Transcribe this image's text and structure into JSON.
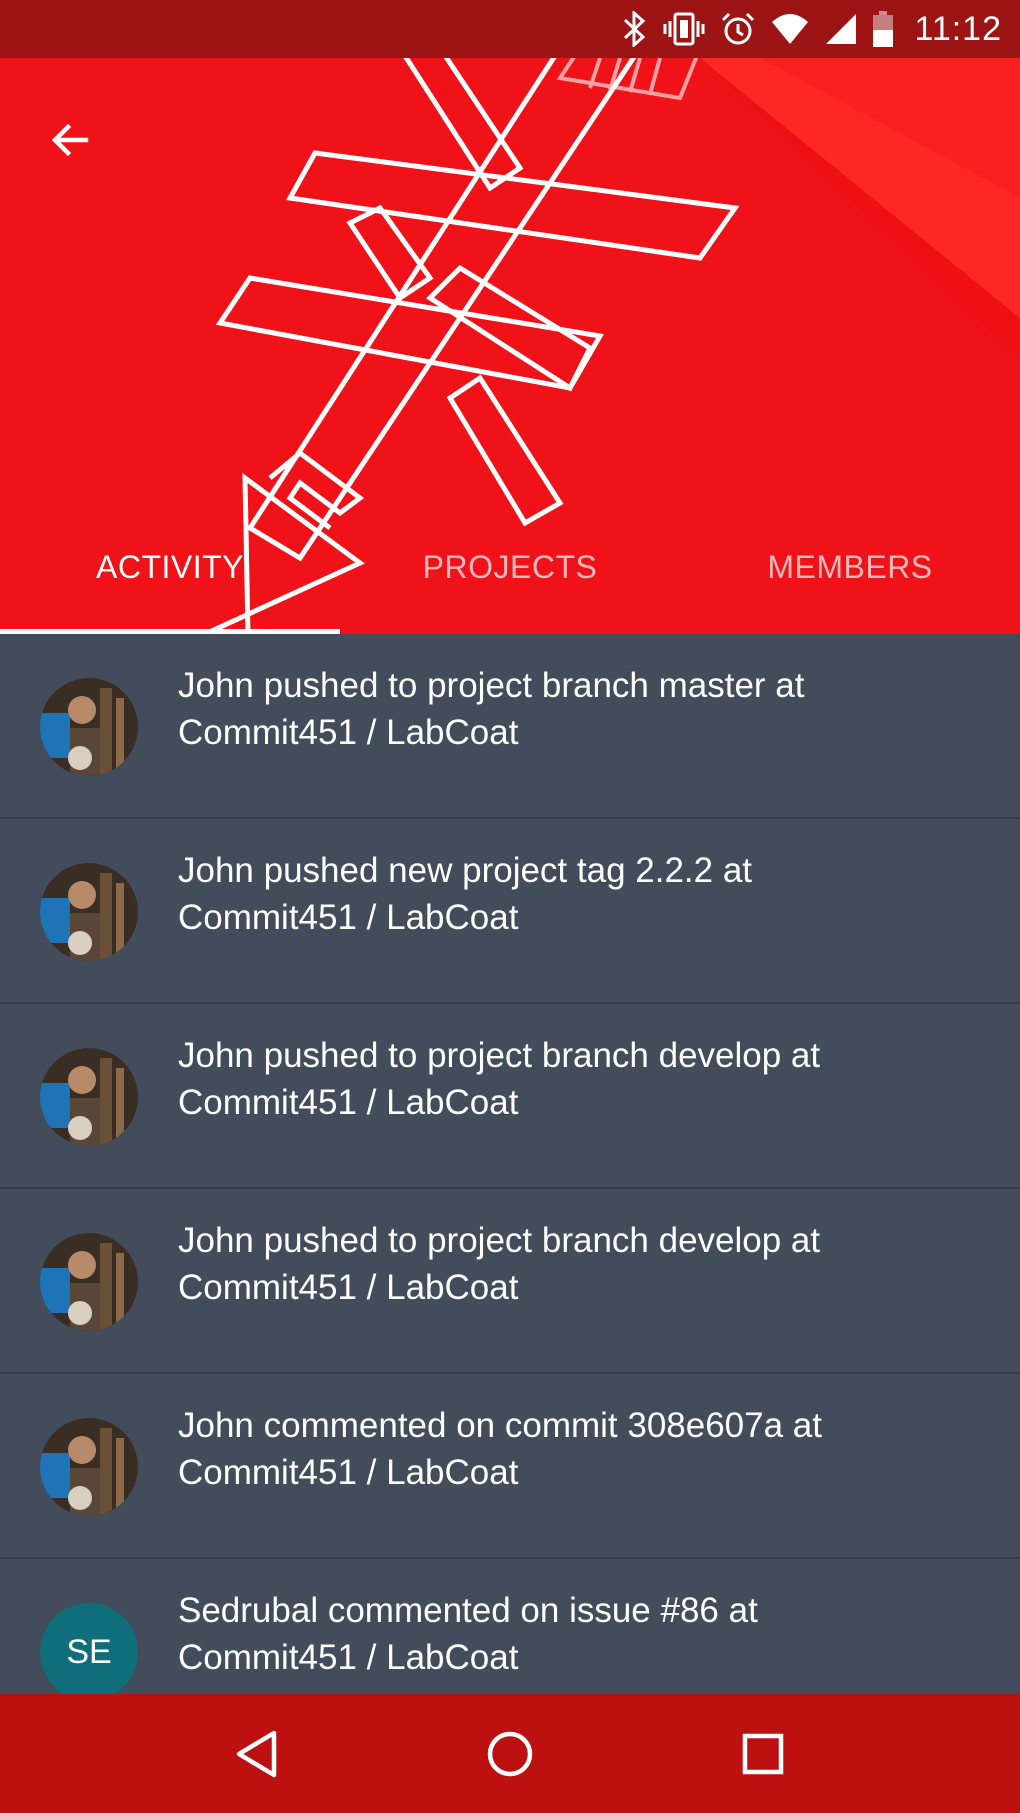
{
  "status_bar": {
    "time": "11:12",
    "icons": [
      "bluetooth-icon",
      "vibrate-icon",
      "alarm-icon",
      "wifi-icon",
      "cell-signal-icon",
      "battery-icon"
    ]
  },
  "header": {
    "back_icon": "arrow-back-icon",
    "background_color": "#ee1015",
    "tabs": [
      {
        "label": "ACTIVITY",
        "active": true
      },
      {
        "label": "PROJECTS",
        "active": false
      },
      {
        "label": "MEMBERS",
        "active": false
      }
    ]
  },
  "activity": {
    "items": [
      {
        "line1": "John pushed to project branch master at",
        "line2": "Commit451 / LabCoat",
        "avatar": "photo"
      },
      {
        "line1": "John pushed new project tag 2.2.2 at",
        "line2": "Commit451 / LabCoat",
        "avatar": "photo"
      },
      {
        "line1": "John pushed to project branch develop at",
        "line2": "Commit451 / LabCoat",
        "avatar": "photo"
      },
      {
        "line1": "John pushed to project branch develop at",
        "line2": "Commit451 / LabCoat",
        "avatar": "photo"
      },
      {
        "line1": "John commented on commit 308e607a at",
        "line2": "Commit451 / LabCoat",
        "avatar": "photo"
      },
      {
        "line1": "Sedrubal commented on issue #86 at",
        "line2": "Commit451 / LabCoat",
        "avatar": "initials",
        "initials": "SE"
      }
    ]
  },
  "nav_bar": {
    "buttons": [
      "back-triangle-icon",
      "home-circle-icon",
      "recents-square-icon"
    ]
  },
  "colors": {
    "status_bar": "#9c1414",
    "header": "#ee1015",
    "list_background": "#424c5a",
    "nav_bar": "#bd1010",
    "avatar_initials_bg": "#0e6e7a"
  }
}
